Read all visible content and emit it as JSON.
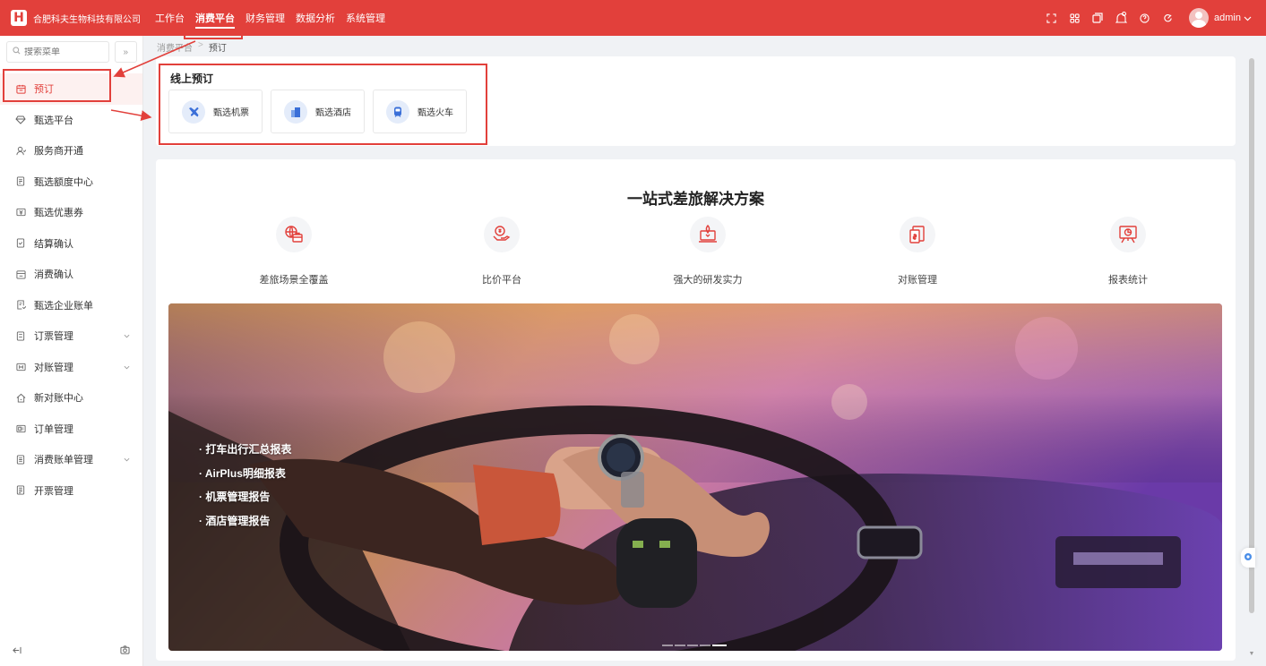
{
  "header": {
    "logo_text": "H",
    "company": "合肥科夫生物科技有限公司",
    "nav": [
      {
        "label": "工作台",
        "active": false
      },
      {
        "label": "消费平台",
        "active": true
      },
      {
        "label": "财务管理",
        "active": false
      },
      {
        "label": "数据分析",
        "active": false
      },
      {
        "label": "系统管理",
        "active": false
      }
    ],
    "icons": [
      "fullscreen-icon",
      "grid-icon",
      "window-icon",
      "bell-icon",
      "help-icon",
      "settings-icon"
    ],
    "username": "admin",
    "accent_color": "#e2403b"
  },
  "sidebar": {
    "search_placeholder": "搜索菜单",
    "collapse_symbol": "»",
    "items": [
      {
        "label": "预订",
        "icon": "calendar-icon",
        "active": true,
        "has_children": false
      },
      {
        "label": "甄选平台",
        "icon": "diamond-icon",
        "active": false,
        "has_children": false
      },
      {
        "label": "服务商开通",
        "icon": "user-icon",
        "active": false,
        "has_children": false
      },
      {
        "label": "甄选额度中心",
        "icon": "document-icon",
        "active": false,
        "has_children": false
      },
      {
        "label": "甄选优惠券",
        "icon": "coupon-icon",
        "active": false,
        "has_children": false
      },
      {
        "label": "结算确认",
        "icon": "check-document-icon",
        "active": false,
        "has_children": false
      },
      {
        "label": "消费确认",
        "icon": "calendar-check-icon",
        "active": false,
        "has_children": false
      },
      {
        "label": "甄选企业账单",
        "icon": "bill-icon",
        "active": false,
        "has_children": false
      },
      {
        "label": "订票管理",
        "icon": "ticket-icon",
        "active": false,
        "has_children": true
      },
      {
        "label": "对账管理",
        "icon": "reconcile-icon",
        "active": false,
        "has_children": true
      },
      {
        "label": "新对账中心",
        "icon": "home-icon",
        "active": false,
        "has_children": false
      },
      {
        "label": "订单管理",
        "icon": "order-icon",
        "active": false,
        "has_children": false
      },
      {
        "label": "消费账单管理",
        "icon": "list-icon",
        "active": false,
        "has_children": true
      },
      {
        "label": "开票管理",
        "icon": "invoice-icon",
        "active": false,
        "has_children": false
      }
    ]
  },
  "breadcrumb": {
    "parent": "消费平台",
    "separator": ">",
    "current": "预订"
  },
  "booking": {
    "title": "线上预订",
    "items": [
      {
        "label": "甄选机票",
        "icon": "plane-icon"
      },
      {
        "label": "甄选酒店",
        "icon": "hotel-icon"
      },
      {
        "label": "甄选火车",
        "icon": "train-icon"
      }
    ]
  },
  "solution": {
    "title": "一站式差旅解决方案",
    "features": [
      {
        "label": "差旅场景全覆盖",
        "icon": "briefcase-globe-icon"
      },
      {
        "label": "比价平台",
        "icon": "money-hand-icon"
      },
      {
        "label": "强大的研发实力",
        "icon": "rocket-laptop-icon"
      },
      {
        "label": "对账管理",
        "icon": "reconcile-bill-icon"
      },
      {
        "label": "报表统计",
        "icon": "presentation-chart-icon"
      }
    ],
    "banner_points": [
      "· 打车出行汇总报表",
      "· AirPlus明细报表",
      "· 机票管理报告",
      "· 酒店管理报告"
    ],
    "carousel_count": 5,
    "carousel_active": 4
  }
}
